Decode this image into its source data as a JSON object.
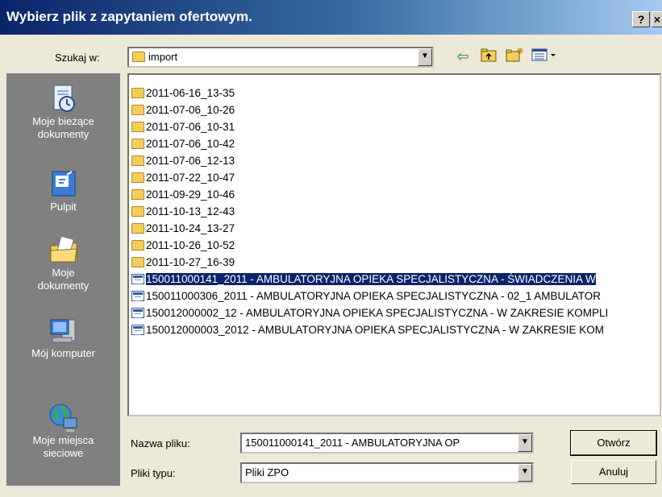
{
  "dialog": {
    "title": "Wybierz plik z zapytaniem ofertowym.",
    "help_label": "?",
    "close_label": "×"
  },
  "lookin": {
    "label": "Szukaj w:",
    "value": "import"
  },
  "places": [
    {
      "label_line1": "Moje bieżące",
      "label_line2": "dokumenty",
      "icon": "recent-documents-icon"
    },
    {
      "label_line1": "Pulpit",
      "label_line2": "",
      "icon": "desktop-icon"
    },
    {
      "label_line1": "Moje",
      "label_line2": "dokumenty",
      "icon": "my-documents-icon"
    },
    {
      "label_line1": "Mój komputer",
      "label_line2": "",
      "icon": "my-computer-icon"
    },
    {
      "label_line1": "Moje miejsca",
      "label_line2": "sieciowe",
      "icon": "network-places-icon"
    }
  ],
  "files": [
    {
      "name": "2011-06-16_13-35",
      "type": "folder"
    },
    {
      "name": "2011-07-06_10-26",
      "type": "folder"
    },
    {
      "name": "2011-07-06_10-31",
      "type": "folder"
    },
    {
      "name": "2011-07-06_10-42",
      "type": "folder"
    },
    {
      "name": "2011-07-06_12-13",
      "type": "folder"
    },
    {
      "name": "2011-07-22_10-47",
      "type": "folder"
    },
    {
      "name": "2011-09-29_10-46",
      "type": "folder"
    },
    {
      "name": "2011-10-13_12-43",
      "type": "folder"
    },
    {
      "name": "2011-10-24_13-27",
      "type": "folder"
    },
    {
      "name": "2011-10-26_10-52",
      "type": "folder"
    },
    {
      "name": "2011-10-27_16-39",
      "type": "folder"
    },
    {
      "name": "150011000141_2011 - AMBULATORYJNA OPIEKA SPECJALISTYCZNA - ŚWIADCZENIA W",
      "type": "file",
      "selected": true
    },
    {
      "name": "150011000306_2011 - AMBULATORYJNA OPIEKA SPECJALISTYCZNA  - 02_1 AMBULATOR",
      "type": "file"
    },
    {
      "name": "150012000002_12 - AMBULATORYJNA OPIEKA SPECJALISTYCZNA - W ZAKRESIE KOMPLI",
      "type": "file"
    },
    {
      "name": "150012000003_2012 - AMBULATORYJNA OPIEKA SPECJALISTYCZNA - W ZAKRESIE KOM",
      "type": "file"
    }
  ],
  "filename": {
    "label": "Nazwa pliku:",
    "value": "150011000141_2011 - AMBULATORYJNA OP"
  },
  "filetype": {
    "label": "Pliki typu:",
    "value": "Pliki ZPO"
  },
  "buttons": {
    "open": "Otwórz",
    "cancel": "Anuluj"
  },
  "colors": {
    "title_start": "#0a246a",
    "title_end": "#a6caf0",
    "selection": "#0a246a",
    "places_bar": "#808080",
    "dialog_bg": "#ece9d8"
  }
}
